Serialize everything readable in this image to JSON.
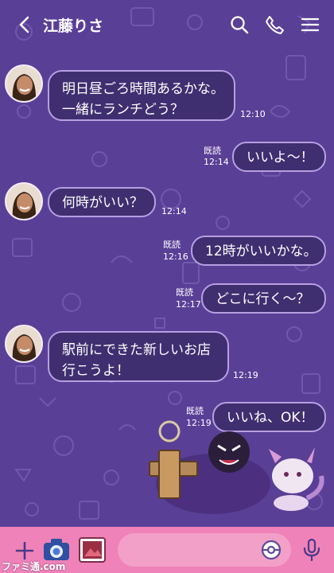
{
  "header": {
    "title": "江藤りさ",
    "icons": [
      "back-chevron-icon",
      "search-icon",
      "phone-icon",
      "menu-icon"
    ]
  },
  "messages": [
    {
      "direction": "in",
      "text": "明日昼ごろ時間あるかな。\n一緒にランチどう？",
      "time": "12:10"
    },
    {
      "direction": "out",
      "text": "いいよ～！",
      "time": "12:14",
      "read": "既読"
    },
    {
      "direction": "in",
      "text": "何時がいい？",
      "time": "12:14"
    },
    {
      "direction": "out",
      "text": "12時がいいかな。",
      "time": "12:16",
      "read": "既読"
    },
    {
      "direction": "out",
      "text": "どこに行く～？",
      "time": "12:17",
      "read": "既読"
    },
    {
      "direction": "in",
      "text": "駅前にできた新しいお店\n行こうよ！",
      "time": "12:19"
    },
    {
      "direction": "out",
      "text": "いいね、OK！",
      "time": "12:19",
      "read": "既読"
    }
  ],
  "sticker": {
    "name": "ghost-pokemon-sticker"
  },
  "footer": {
    "icons": [
      "plus-icon",
      "camera-icon",
      "image-icon",
      "pokeball-icon",
      "microphone-icon"
    ]
  },
  "watermark": "ファミ通.com",
  "colors": {
    "background": "#5a3f97",
    "bubble": "#3f2f70",
    "bubble_border": "#b79fe0",
    "footer": "#ef82b8"
  }
}
